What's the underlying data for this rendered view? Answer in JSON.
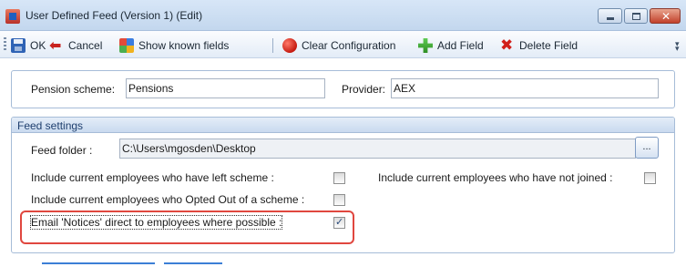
{
  "window": {
    "title": "User Defined Feed (Version 1) (Edit)"
  },
  "toolbar": {
    "ok_label": "OK",
    "cancel_label": "Cancel",
    "show_known_fields_label": "Show known fields",
    "clear_configuration_label": "Clear Configuration",
    "add_field_label": "Add Field",
    "delete_field_label": "Delete Field"
  },
  "scheme": {
    "pension_scheme_label": "Pension scheme:",
    "pension_scheme_value": "Pensions",
    "provider_label": "Provider:",
    "provider_value": "AEX"
  },
  "feed_settings": {
    "title": "Feed settings",
    "feed_folder_label": "Feed folder :",
    "feed_folder_value": "C:\\Users\\mgosden\\Desktop",
    "browse_label": "...",
    "options": [
      {
        "label": "Include current employees who have left scheme :",
        "checked": false
      },
      {
        "label": "Include current employees who have not joined :",
        "checked": false
      },
      {
        "label": "Include current employees who Opted Out of a scheme :",
        "checked": false
      },
      {
        "label": "Email 'Notices' direct to employees where possible :",
        "checked": true
      }
    ]
  },
  "colors": {
    "highlight": "#e0473f",
    "accent": "#3c7fd6"
  }
}
